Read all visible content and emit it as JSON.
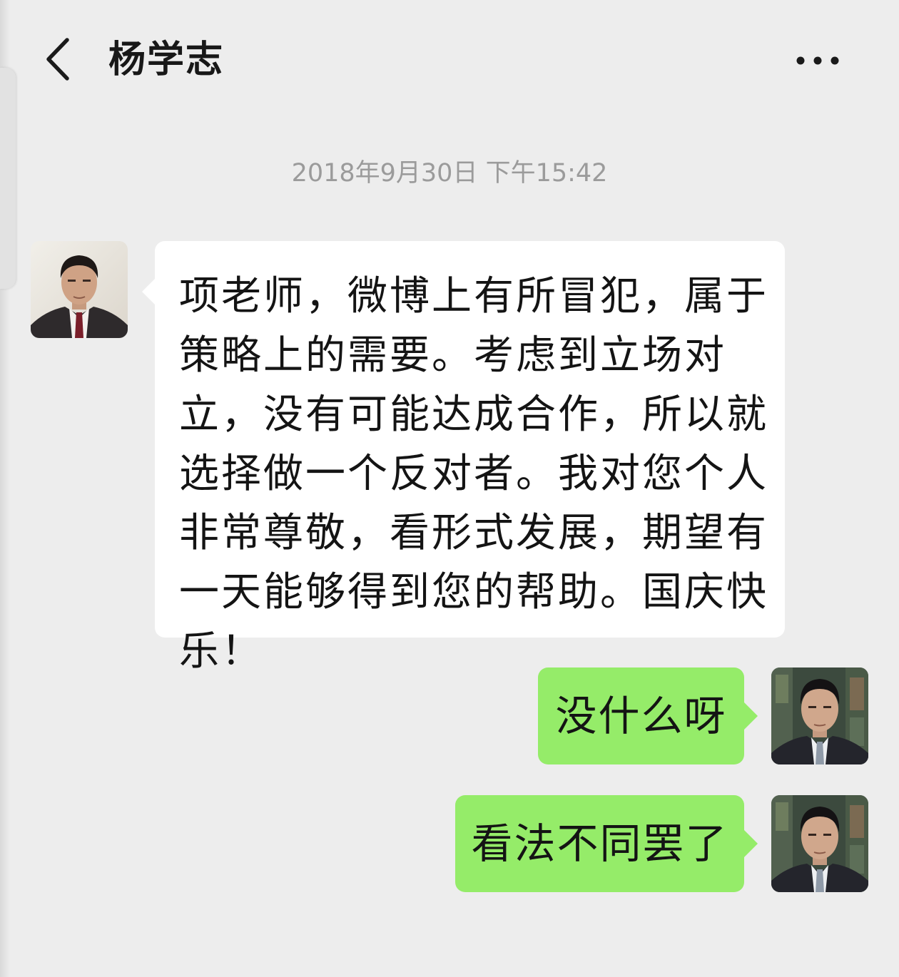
{
  "header": {
    "title": "杨学志",
    "back_icon": "chevron-left-icon",
    "more_icon": "more-dots-icon"
  },
  "chat": {
    "timestamp": "2018年9月30日 下午15:42",
    "messages": [
      {
        "direction": "incoming",
        "sender": "杨学志",
        "text": "项老师，微博上有所冒犯，属于策略上的需要。考虑到立场对立，没有可能达成合作，所以就选择做一个反对者。我对您个人非常尊敬，看形式发展，期望有一天能够得到您的帮助。国庆快乐！"
      },
      {
        "direction": "outgoing",
        "text": "没什么呀"
      },
      {
        "direction": "outgoing",
        "text": "看法不同罢了"
      }
    ]
  },
  "colors": {
    "background": "#ededed",
    "incoming_bubble": "#ffffff",
    "outgoing_bubble": "#95ec69",
    "timestamp": "#9b9b9b"
  }
}
